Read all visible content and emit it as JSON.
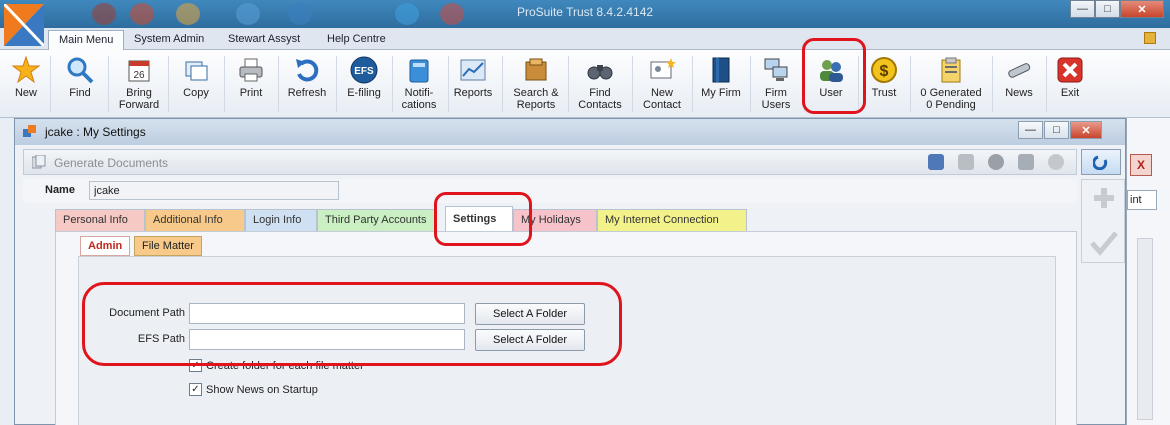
{
  "app": {
    "title": "ProSuite Trust 8.4.2.4142"
  },
  "menu_tabs": [
    {
      "label": "Main Menu",
      "active": true
    },
    {
      "label": "System Admin",
      "active": false
    },
    {
      "label": "Stewart Assyst",
      "active": false
    },
    {
      "label": "Help Centre",
      "active": false
    }
  ],
  "ribbon": [
    {
      "label": "New",
      "icon": "star-icon"
    },
    {
      "label": "Find",
      "icon": "magnifier-icon"
    },
    {
      "label": "Bring\nForward",
      "icon": "calendar-icon"
    },
    {
      "label": "Copy",
      "icon": "copy-icon"
    },
    {
      "label": "Print",
      "icon": "printer-icon"
    },
    {
      "label": "Refresh",
      "icon": "refresh-icon"
    },
    {
      "label": "E-filing",
      "icon": "efs-icon"
    },
    {
      "label": "Notifi-\ncations",
      "icon": "notifications-icon"
    },
    {
      "label": "Reports",
      "icon": "chart-icon"
    },
    {
      "label": "Search &\nReports",
      "icon": "search-reports-icon"
    },
    {
      "label": "Find\nContacts",
      "icon": "binoculars-icon"
    },
    {
      "label": "New\nContact",
      "icon": "new-contact-icon"
    },
    {
      "label": "My Firm",
      "icon": "book-icon"
    },
    {
      "label": "Firm\nUsers",
      "icon": "computers-icon"
    },
    {
      "label": "User",
      "icon": "users-icon"
    },
    {
      "label": "Trust",
      "icon": "dollar-icon"
    },
    {
      "label": "0 Generated\n0 Pending",
      "icon": "clipboard-icon"
    },
    {
      "label": "News",
      "icon": "telescope-icon"
    },
    {
      "label": "Exit",
      "icon": "exit-icon"
    }
  ],
  "settings_window": {
    "title": "jcake : My Settings",
    "generate_documents": "Generate Documents",
    "name_label": "Name",
    "name_value": "jcake",
    "tabs": [
      {
        "label": "Personal Info",
        "color": "#f6c9c4"
      },
      {
        "label": "Additional Info",
        "color": "#f7c98a"
      },
      {
        "label": "Login Info",
        "color": "#cfe0f3"
      },
      {
        "label": "Third Party Accounts",
        "color": "#c9efc2"
      },
      {
        "label": "Settings",
        "color": "#ffffff",
        "active": true
      },
      {
        "label": "My Holidays",
        "color": "#f6c3cb"
      },
      {
        "label": "My Internet Connection",
        "color": "#f3f28a"
      }
    ],
    "subtabs": [
      {
        "label": "Admin",
        "active": true
      },
      {
        "label": "File Matter",
        "active": false
      }
    ],
    "document_path_label": "Document Path",
    "document_path_value": "",
    "efs_path_label": "EFS Path",
    "efs_path_value": "",
    "select_folder_label": "Select A Folder",
    "create_folder_label": "Create folder for each file matter",
    "create_folder_checked": true,
    "show_news_label": "Show News on Startup",
    "show_news_checked": true
  },
  "background_window": {
    "close_glyph": "X",
    "button_fragment": "int"
  },
  "colors": {
    "accent_red": "#e0141c",
    "title_blue": "#3f88bd"
  }
}
